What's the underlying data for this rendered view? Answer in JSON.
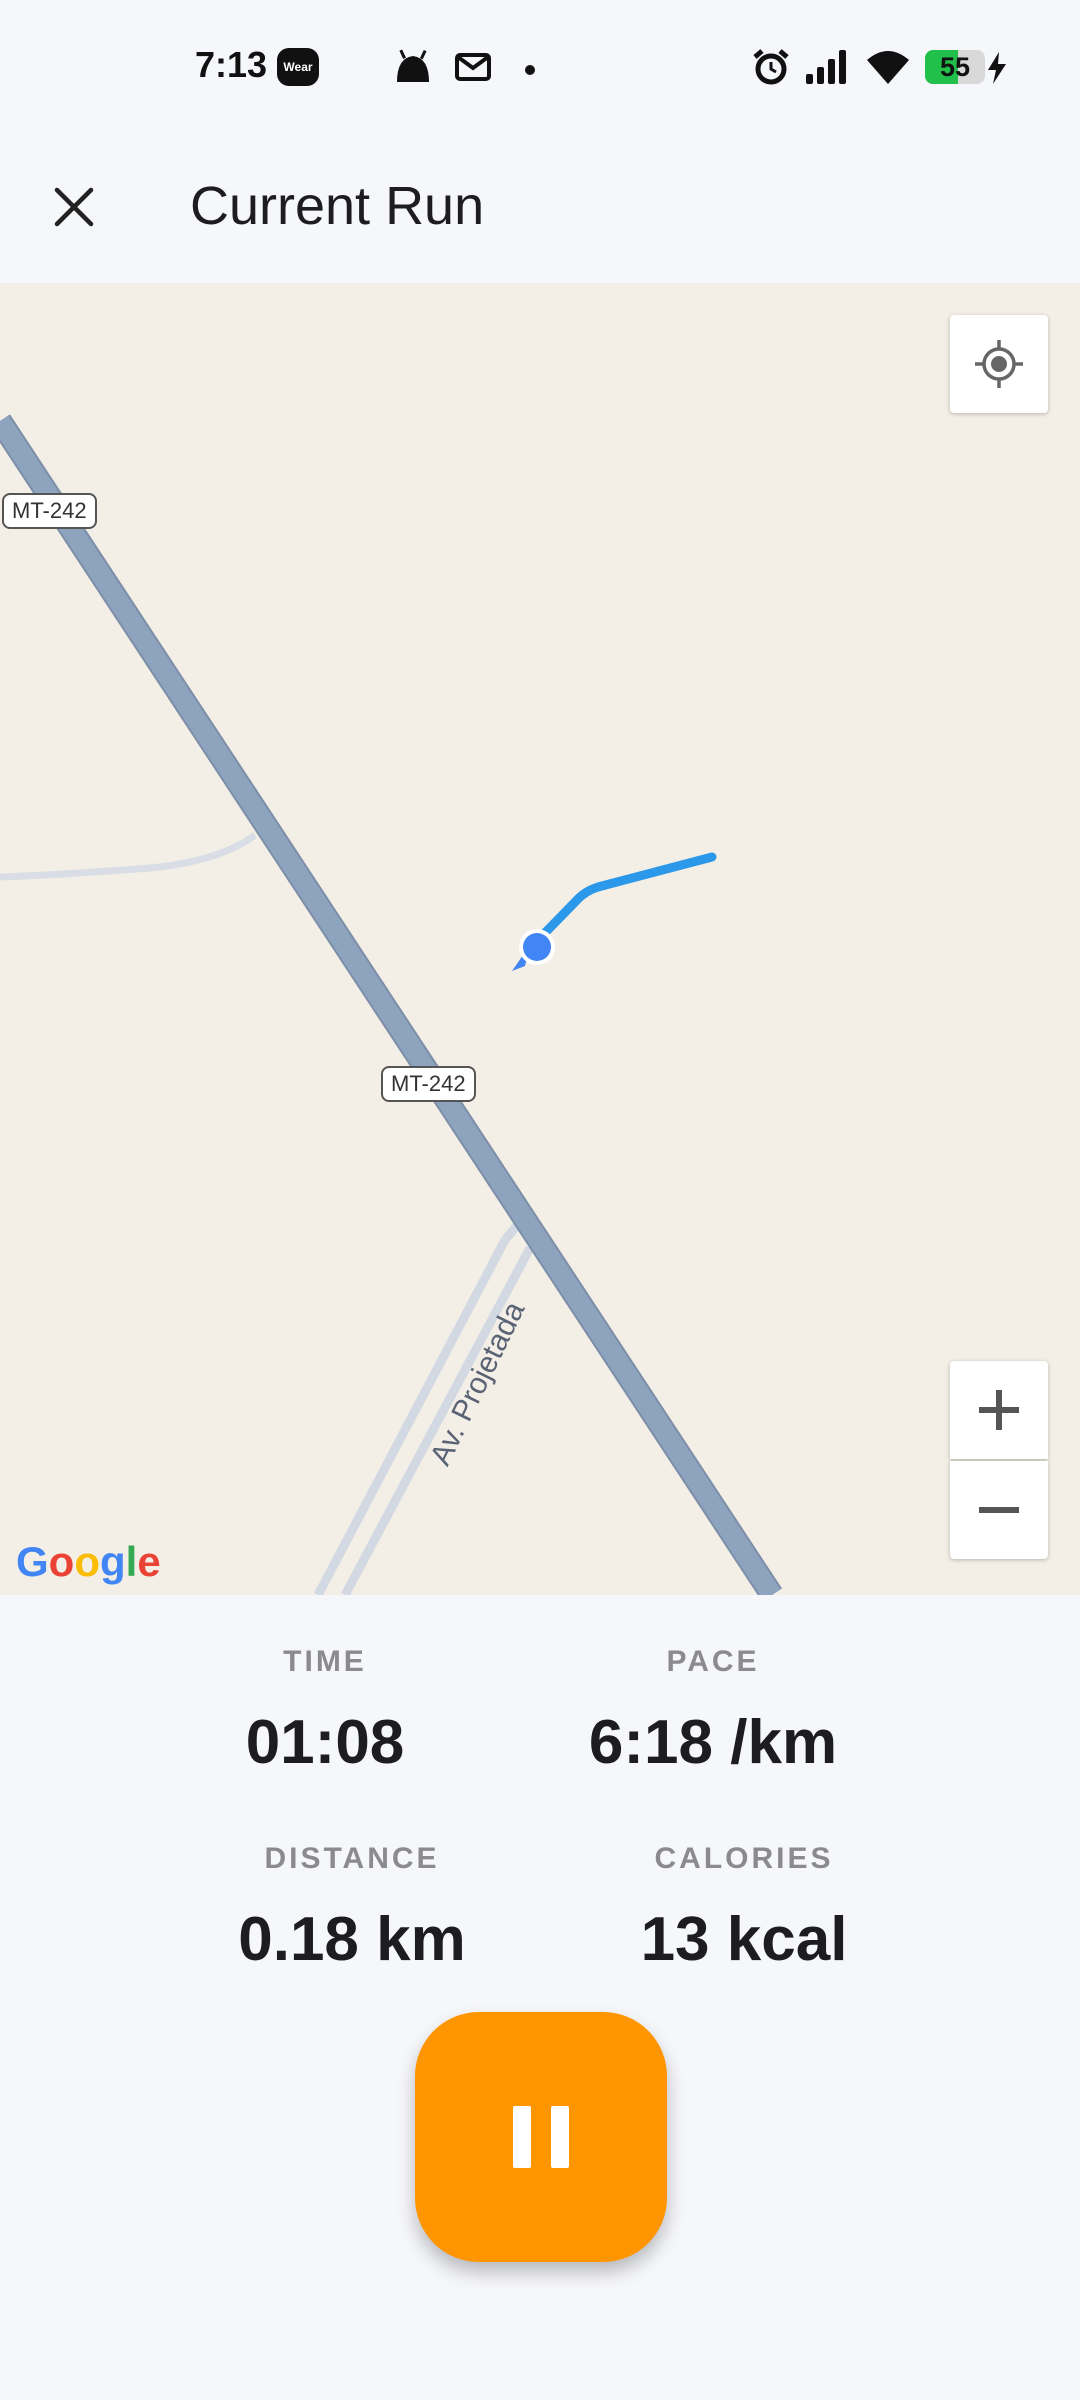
{
  "status_bar": {
    "time": "7:13",
    "wear_badge": "Wear",
    "battery_percent": "55",
    "battery_level": 0.55,
    "icons": [
      "wear-icon",
      "android-icon",
      "mail-icon",
      "dot-icon",
      "alarm-icon",
      "signal-icon",
      "wifi-icon",
      "battery-icon",
      "charging-icon"
    ]
  },
  "app_bar": {
    "title": "Current Run",
    "close_icon": "close-icon"
  },
  "map": {
    "road_labels": [
      "MT-242",
      "MT-242"
    ],
    "street_label": "Av. Projetada",
    "attribution": "Google",
    "controls": {
      "locate_icon": "my-location-icon",
      "zoom_in_label": "+",
      "zoom_out_label": "−"
    },
    "colors": {
      "background": "#f3efe6",
      "highway": "#8ea3be",
      "minor_road": "#d9dee6",
      "route": "#2b98ea",
      "position_dot": "#4285f4"
    }
  },
  "stats": {
    "time": {
      "label": "TIME",
      "value": "01:08"
    },
    "pace": {
      "label": "PACE",
      "value": "6:18 /km"
    },
    "distance": {
      "label": "DISTANCE",
      "value": "0.18 km"
    },
    "calories": {
      "label": "CALORIES",
      "value": "13 kcal"
    }
  },
  "controls": {
    "pause_icon": "pause-icon",
    "accent_color": "#ff9500"
  }
}
